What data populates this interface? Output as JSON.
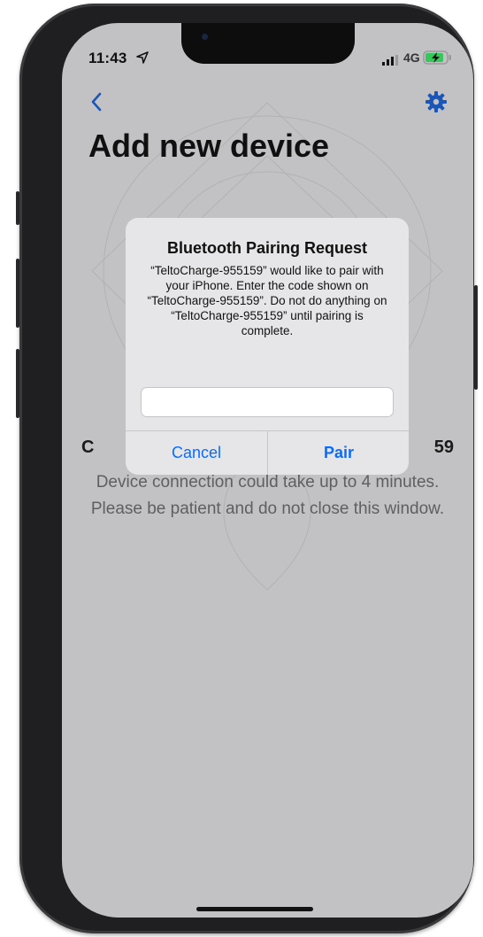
{
  "status_bar": {
    "time": "11:43",
    "network": "4G",
    "icons": [
      "location-arrow-icon",
      "signal-bars-icon",
      "battery-charging-icon"
    ]
  },
  "nav": {
    "back_icon": "chevron-left-icon",
    "settings_icon": "gear-icon"
  },
  "page": {
    "title": "Add new device",
    "connecting_left": "C",
    "connecting_right": "59",
    "info_text": "Device connection could take up to 4 minutes. Please be patient and do not close this window."
  },
  "alert": {
    "title": "Bluetooth Pairing Request",
    "message": "“TeltoCharge-955159” would like to pair with your iPhone. Enter the code shown on “TeltoCharge-955159”. Do not do anything on “TeltoCharge-955159” until pairing is complete.",
    "input_value": "",
    "cancel_label": "Cancel",
    "pair_label": "Pair"
  },
  "colors": {
    "accent": "#0a6cff",
    "nav_icon": "#1a56b8",
    "screen_background": "#c2c2c4",
    "alert_background": "#e6e6e8"
  }
}
